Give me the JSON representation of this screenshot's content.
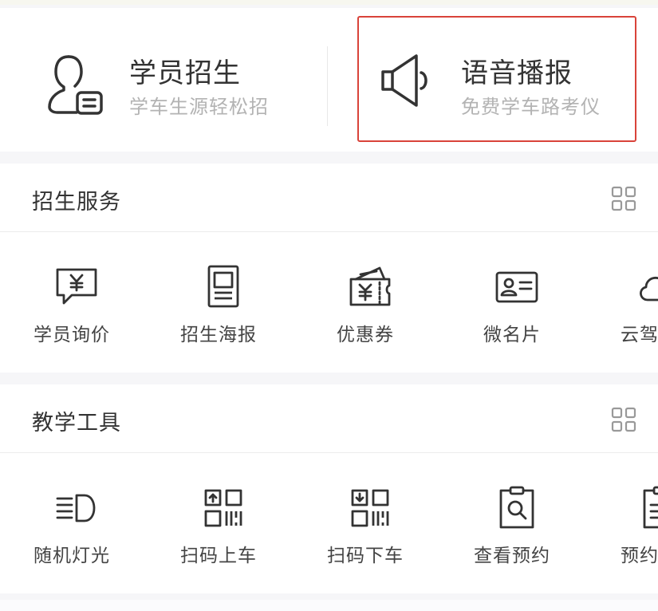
{
  "features": [
    {
      "title": "学员招生",
      "subtitle": "学车生源轻松招",
      "icon": "student-profile-icon"
    },
    {
      "title": "语音播报",
      "subtitle": "免费学车路考仪",
      "icon": "speaker-icon",
      "highlighted": true
    }
  ],
  "sections": [
    {
      "title": "招生服务",
      "more_icon": "grid-icon",
      "items": [
        {
          "label": "学员询价",
          "icon": "price-inquiry-icon"
        },
        {
          "label": "招生海报",
          "icon": "poster-icon"
        },
        {
          "label": "优惠券",
          "icon": "coupon-icon"
        },
        {
          "label": "微名片",
          "icon": "business-card-icon"
        },
        {
          "label": "云驾",
          "icon": "cloud-icon"
        }
      ]
    },
    {
      "title": "教学工具",
      "more_icon": "grid-icon",
      "items": [
        {
          "label": "随机灯光",
          "icon": "headlight-icon"
        },
        {
          "label": "扫码上车",
          "icon": "scan-board-icon"
        },
        {
          "label": "扫码下车",
          "icon": "scan-alight-icon"
        },
        {
          "label": "查看预约",
          "icon": "view-appointment-icon"
        },
        {
          "label": "预约",
          "icon": "appointment-icon"
        }
      ]
    }
  ],
  "colors": {
    "highlight_border": "#d9433a",
    "icon_stroke": "#333333",
    "subtitle": "#b3b3b3"
  }
}
